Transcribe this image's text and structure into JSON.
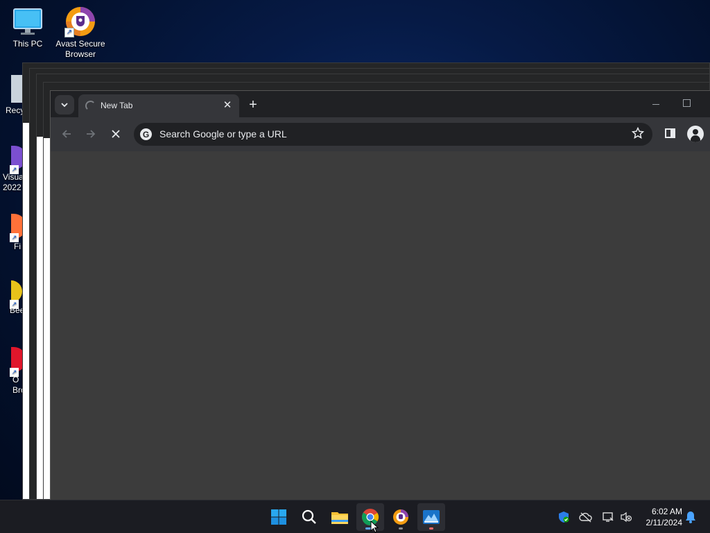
{
  "desktop": {
    "icons": [
      {
        "label": "This PC"
      },
      {
        "label": "Avast Secure Browser"
      }
    ],
    "partial_labels": [
      "Recy",
      "Visua 2022",
      "Fi",
      "Bee",
      "O Bro"
    ]
  },
  "browser": {
    "tab_title": "New Tab",
    "new_tab_symbol": "+",
    "tab_close_symbol": "✕",
    "omnibox_placeholder": "Search Google or type a URL",
    "google_glyph": "G"
  },
  "taskbar": {
    "pinned": [
      {
        "name": "Start"
      },
      {
        "name": "Search"
      },
      {
        "name": "File Explorer"
      },
      {
        "name": "Google Chrome",
        "active": true
      },
      {
        "name": "Avast Secure Browser"
      },
      {
        "name": "Photos"
      }
    ],
    "clock_time": "6:02 AM",
    "clock_date": "2/11/2024"
  },
  "colors": {
    "accent": "#5ea5ff",
    "chrome_dark": "#202124",
    "chrome_tab": "#35363a"
  }
}
